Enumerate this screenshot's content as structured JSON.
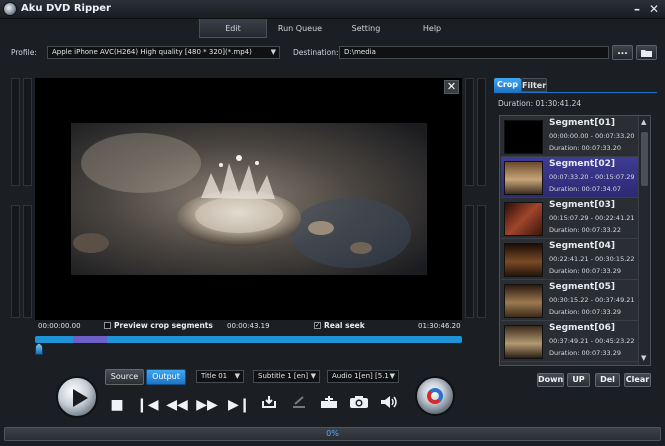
{
  "window": {
    "title": "Aku DVD Ripper"
  },
  "menu": [
    "Edit",
    "Run Queue",
    "Setting",
    "Help"
  ],
  "profile": {
    "label": "Profile:",
    "value": "Apple iPhone AVC(H264) High quality [480 * 320](*.mp4)",
    "destination_label": "Destination:",
    "destination_value": "D:\\media",
    "browse_label": "...",
    "folder_icon": "folder-icon"
  },
  "player": {
    "time_start": "00:00:00.00",
    "preview_crop_label": "Preview crop segments",
    "preview_crop_checked": false,
    "time_current": "00:00:43.19",
    "real_seek_label": "Real seek",
    "real_seek_checked": true,
    "time_end": "01:30:46.20",
    "source_label": "Source",
    "output_label": "Output",
    "title_select": "Title 01",
    "subtitle_select": "Subtitle 1 [en]",
    "audio_select": "Audio 1[en] [5.1",
    "icons": [
      "play-icon",
      "stop-icon",
      "previous-frame-icon",
      "rewind-icon",
      "fast-forward-icon",
      "next-frame-icon",
      "set-start-icon",
      "set-end-icon",
      "split-icon",
      "snapshot-icon",
      "volume-icon"
    ]
  },
  "right_panel": {
    "tabs": [
      "Crop",
      "Filter"
    ],
    "duration_label": "Duration:",
    "duration_value": "01:30:41.24",
    "segments": [
      {
        "name": "Segment[01]",
        "range": "00:00:00.00 - 00:07:33.20",
        "duration": "Duration: 00:07:33.20"
      },
      {
        "name": "Segment[02]",
        "range": "00:07:33.20 - 00:15:07.29",
        "duration": "Duration: 00:07:34.07"
      },
      {
        "name": "Segment[03]",
        "range": "00:15:07.29 - 00:22:41.21",
        "duration": "Duration: 00:07:33.22"
      },
      {
        "name": "Segment[04]",
        "range": "00:22:41.21 - 00:30:15.22",
        "duration": "Duration: 00:07:33.29"
      },
      {
        "name": "Segment[05]",
        "range": "00:30:15.22 - 00:37:49.21",
        "duration": "Duration: 00:07:33.29"
      },
      {
        "name": "Segment[06]",
        "range": "00:37:49.21 - 00:45:23.22",
        "duration": "Duration: 00:07:33.29"
      }
    ],
    "selected_segment": 1,
    "buttons": [
      "Down",
      "UP",
      "Del",
      "Clear"
    ]
  },
  "progress": {
    "text": "0%",
    "value": 0
  },
  "colors": {
    "accent": "#1f93d6",
    "selected": "#3e3c95",
    "progress_text": "#56a8ff"
  }
}
